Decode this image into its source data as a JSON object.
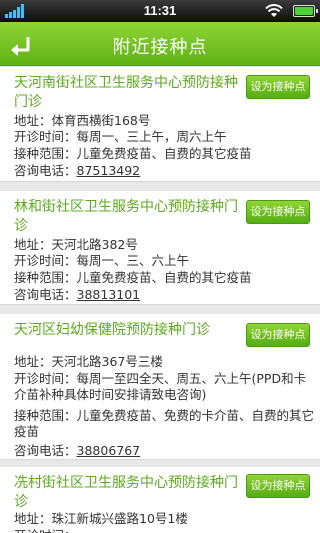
{
  "status_bar": {
    "time": "11:31"
  },
  "header": {
    "title": "附近接种点"
  },
  "set_button_label": "设为接种点",
  "labels": {
    "address": "地址：",
    "hours": "开诊时间：",
    "scope": "接种范围：",
    "phone": "咨询电话："
  },
  "clinics": [
    {
      "name": "天河南街社区卫生服务中心预防接种门诊",
      "address": "体育西横街168号",
      "hours": "每周一、三上午，周六上午",
      "scope": "儿童免费疫苗、自费的其它疫苗",
      "phone": "87513492"
    },
    {
      "name": "林和街社区卫生服务中心预防接种门诊",
      "address": "天河北路382号",
      "hours": "每周一、三、六上午",
      "scope": "儿童免费疫苗、自费的其它疫苗",
      "phone": "38813101"
    },
    {
      "name": "天河区妇幼保健院预防接种门诊",
      "address": "天河北路367号三楼",
      "hours": "每周一至四全天、周五、六上午(PPD和卡介苗补种具体时间安排请致电咨询)",
      "scope": "儿童免费疫苗、免费的卡介苗、自费的其它疫苗",
      "phone": "38806767"
    },
    {
      "name": "冼村街社区卫生服务中心预防接种门诊",
      "address": "珠江新城兴盛路10号1楼",
      "hours": "",
      "scope": "",
      "phone": ""
    }
  ]
}
